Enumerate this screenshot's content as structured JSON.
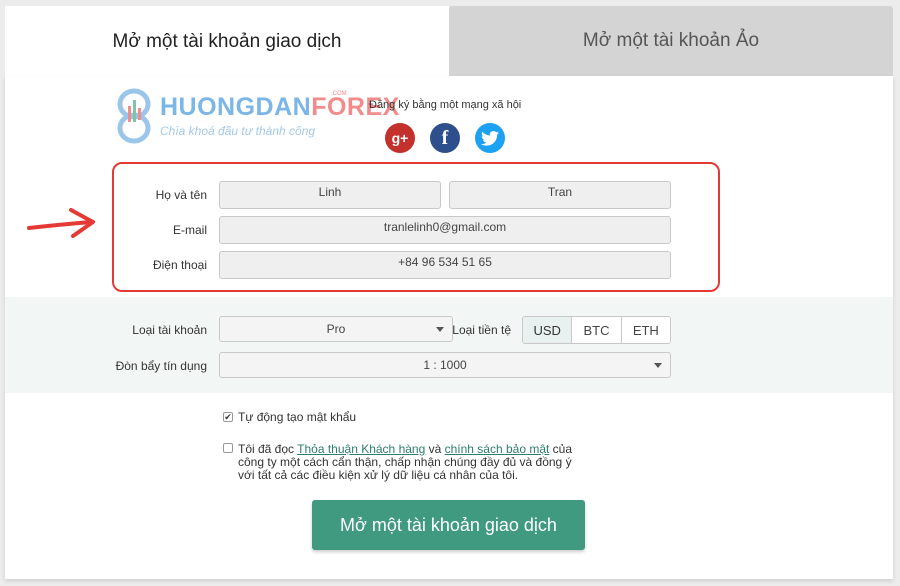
{
  "tabs": {
    "active_label": "Mở một tài khoản giao dịch",
    "inactive_label": "Mở một tài khoản Ảo"
  },
  "logo": {
    "brand_part1": "HUONGDAN",
    "brand_part2": "FOREX",
    "suffix": ".COM",
    "slogan": "Chìa khoá đầu tư thành công"
  },
  "social": {
    "label": "Đăng ký bằng một mạng xã hội",
    "gplus": "g+",
    "facebook": "f"
  },
  "form": {
    "name_label": "Họ và tên",
    "first_name_value": "Linh",
    "last_name_value": "Tran",
    "email_label": "E-mail",
    "email_value": "tranlelinh0@gmail.com",
    "phone_label": "Điện thoại",
    "phone_value": "+84 96 534 51 65"
  },
  "account": {
    "type_label": "Loại tài khoản",
    "type_value": "Pro",
    "currency_label": "Loại tiền tệ",
    "currencies": [
      "USD",
      "BTC",
      "ETH"
    ],
    "selected_currency": "USD",
    "leverage_label": "Đòn bẩy tín dụng",
    "leverage_value": "1 : 1000"
  },
  "checks": {
    "auto_password_label": "Tự động tạo mật khẩu",
    "auto_password_checked": true,
    "agree_part1": "Tôi đã đọc ",
    "agree_link1": "Thỏa thuận Khách hàng",
    "agree_part2": " và ",
    "agree_link2": "chính sách bảo mật",
    "agree_part3": " của công ty một cách cẩn thận, chấp nhận chúng đầy đủ và đồng ý với tất cả các điều kiện xử lý dữ liệu cá nhân của tôi.",
    "agree_checked": false
  },
  "submit_label": "Mở một tài khoản giao dịch",
  "colors": {
    "accent": "#3f9a7f",
    "highlight_border": "#e53935",
    "annotation_arrow": "#e53935"
  }
}
